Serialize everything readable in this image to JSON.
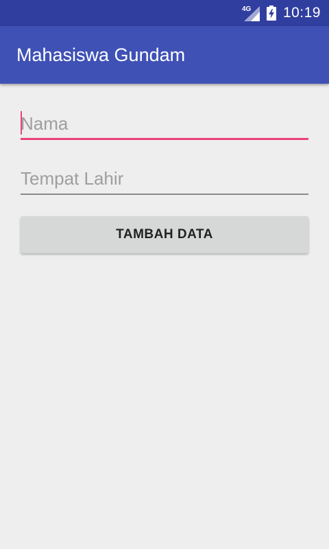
{
  "status_bar": {
    "network_type": "4G",
    "time": "10:19",
    "icons": [
      "signal-icon",
      "battery-charging-icon"
    ],
    "color": "#303f9f"
  },
  "app_bar": {
    "title": "Mahasiswa Gundam",
    "color": "#3f51b5"
  },
  "form": {
    "nama": {
      "placeholder": "Nama",
      "value": "",
      "focused": true
    },
    "tempat_lahir": {
      "placeholder": "Tempat Lahir",
      "value": "",
      "focused": false
    },
    "submit_label": "TAMBAH DATA"
  },
  "colors": {
    "accent": "#ec407a",
    "background": "#eeeeee",
    "button": "#d6d7d7"
  }
}
